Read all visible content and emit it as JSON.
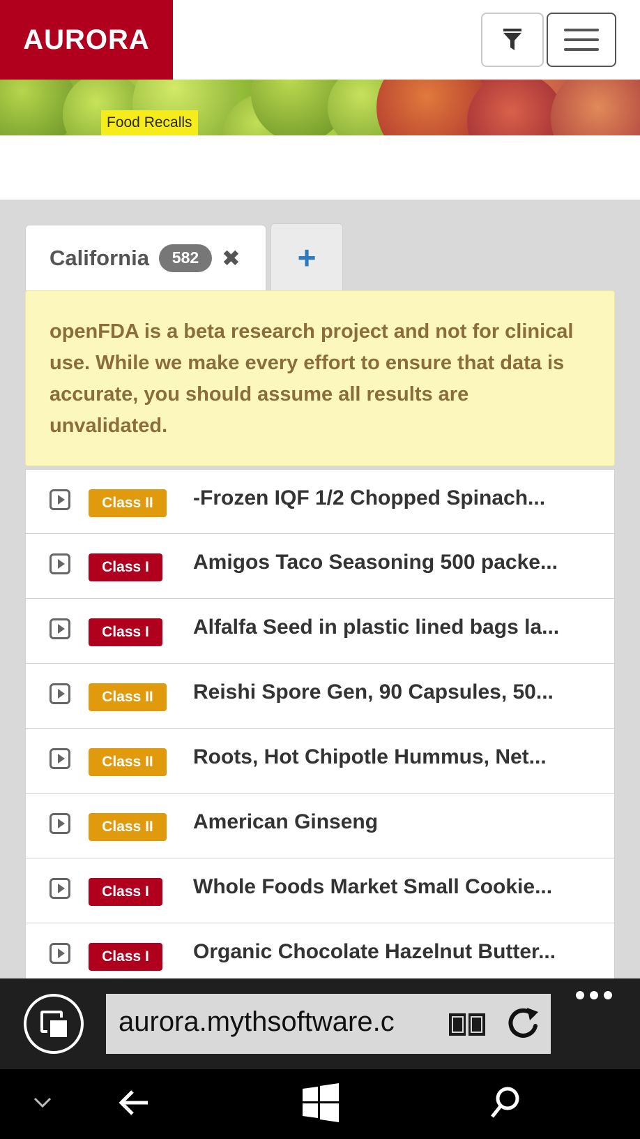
{
  "header": {
    "brand": "AURORA",
    "filter_icon": "filter-icon",
    "menu_icon": "hamburger-menu-icon"
  },
  "banner": {
    "tag": "Food Recalls"
  },
  "tabs": {
    "active_label": "California",
    "active_count": "582",
    "close_glyph": "✖",
    "add_glyph": "+"
  },
  "notice": {
    "text": "openFDA is a beta research project and not for clinical use. While we make every effort to ensure that data is accurate, you should assume all results are unvalidated."
  },
  "recalls": [
    {
      "class": "Class II",
      "title": "-Frozen IQF 1/2 Chopped Spinach..."
    },
    {
      "class": "Class I",
      "title": "Amigos Taco Seasoning 500 packe..."
    },
    {
      "class": "Class I",
      "title": "Alfalfa Seed in plastic lined bags la..."
    },
    {
      "class": "Class II",
      "title": "Reishi Spore Gen, 90 Capsules, 50..."
    },
    {
      "class": "Class II",
      "title": "Roots, Hot Chipotle Hummus, Net..."
    },
    {
      "class": "Class II",
      "title": "American Ginseng"
    },
    {
      "class": "Class I",
      "title": "Whole Foods Market Small Cookie..."
    },
    {
      "class": "Class I",
      "title": "Organic Chocolate Hazelnut Butter..."
    }
  ],
  "colors": {
    "brand_red": "#b0001e",
    "class_ii": "#e19a0c",
    "class_i": "#b0001e",
    "notice_bg": "#fcf8bd",
    "add_blue": "#2e7ac1"
  },
  "browser": {
    "address": "aurora.mythsoftware.c",
    "tabs_icon": "tabs-icon",
    "reading_icon": "reading-view-icon",
    "refresh_icon": "refresh-icon",
    "more_icon": "more-icon"
  },
  "system_bar": {
    "icons": [
      "chevron-down-icon",
      "back-icon",
      "windows-start-icon",
      "search-icon"
    ]
  }
}
